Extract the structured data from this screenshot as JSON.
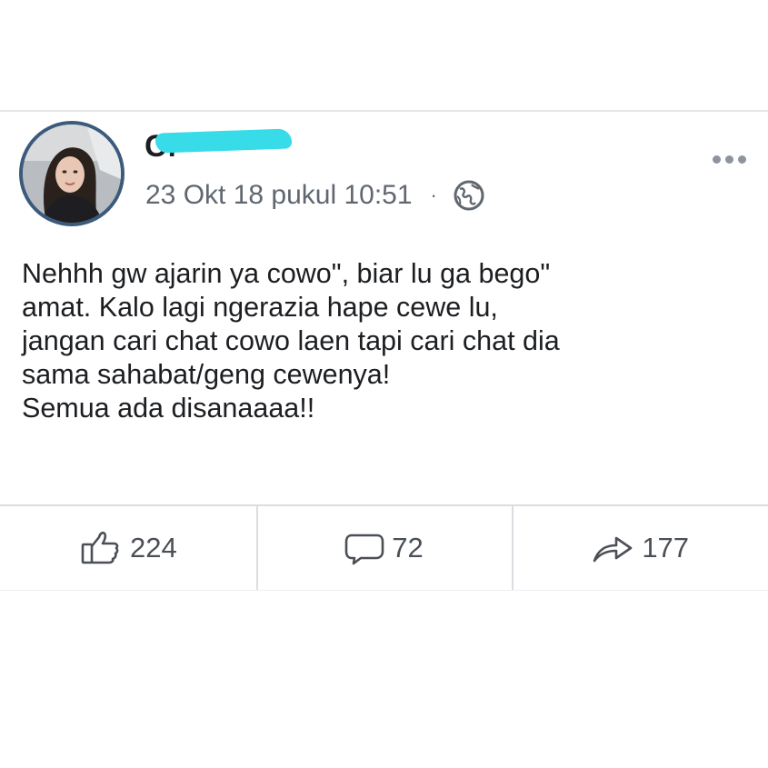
{
  "post": {
    "author": {
      "name": "Cl",
      "name_redacted": true,
      "redaction_color": "#37dce8",
      "avatar": "profile-photo"
    },
    "timestamp": "23 Okt 18 pukul 10:51",
    "separator": "·",
    "privacy_icon": "globe-icon",
    "menu_icon": "more-options-icon",
    "text_lines": [
      "Nehhh gw ajarin ya cowo\", biar lu ga bego\"",
      "amat. Kalo lagi ngerazia hape cewe lu,",
      "jangan cari chat cowo laen tapi cari chat dia",
      "sama sahabat/geng cewenya!",
      "Semua ada disanaaaa!!"
    ]
  },
  "footer": {
    "like": {
      "icon": "thumbs-up-icon",
      "count": "224"
    },
    "comment": {
      "icon": "speech-bubble-icon",
      "count": "72"
    },
    "share": {
      "icon": "share-arrow-icon",
      "count": "177"
    }
  }
}
